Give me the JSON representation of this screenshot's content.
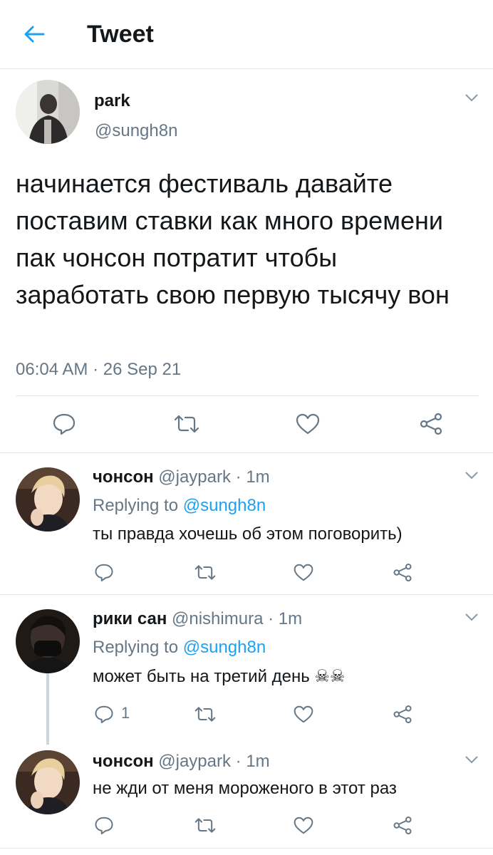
{
  "header": {
    "title": "Tweet"
  },
  "tweet": {
    "name": "park",
    "handle": "@sungh8n",
    "text": "начинается фестиваль давайте поставим ставки как много времени пак чонсон потратит чтобы заработать свою первую тысячу вон",
    "timestamp": "06:04 AM · 26 Sep 21"
  },
  "replies": [
    {
      "name": "чонсон",
      "handle": "@jaypark",
      "age": "1m",
      "replying_prefix": "Replying to ",
      "replying_to": "@sungh8n",
      "text": "ты правда хочешь об этом поговорить)",
      "reply_count": ""
    },
    {
      "name": "рики сан",
      "handle": "@nishimura",
      "age": "1m",
      "replying_prefix": "Replying to ",
      "replying_to": "@sungh8n",
      "text": "может быть на третий день ☠☠",
      "reply_count": "1"
    },
    {
      "name": "чонсон",
      "handle": "@jaypark",
      "age": "1m",
      "text": "не жди от меня мороженого в этот раз",
      "reply_count": ""
    }
  ],
  "meta_separator": " · ",
  "icons": [
    "back-arrow-icon",
    "chevron-down-icon",
    "reply-icon",
    "retweet-icon",
    "like-icon",
    "share-icon"
  ],
  "colors": {
    "accent": "#1da1f2",
    "muted": "#657786",
    "border": "#e1e8ed"
  }
}
